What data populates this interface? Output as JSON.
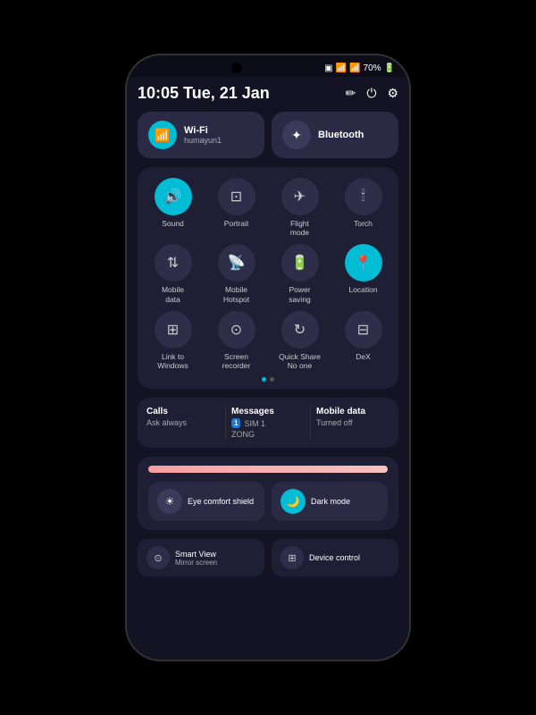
{
  "status_bar": {
    "time": "10:05  Tue, 21 Jan",
    "battery": "70%",
    "battery_icon": "🔋",
    "signal_icon": "📶"
  },
  "header": {
    "pencil_icon": "✏",
    "power_icon": "⏻",
    "settings_icon": "⚙"
  },
  "quick_tiles": {
    "wifi": {
      "label": "Wi-Fi",
      "sublabel": "humayun1",
      "icon": "📶"
    },
    "bluetooth": {
      "label": "Bluetooth",
      "icon": "✦"
    }
  },
  "grid_items": [
    {
      "id": "sound",
      "label": "Sound",
      "icon": "🔊",
      "active": true
    },
    {
      "id": "portrait",
      "label": "Portrait",
      "icon": "⊡",
      "active": false
    },
    {
      "id": "flight",
      "label": "Flight\nmode",
      "icon": "✈",
      "active": false
    },
    {
      "id": "torch",
      "label": "Torch",
      "icon": "🕯",
      "active": false
    },
    {
      "id": "mobile-data",
      "label": "Mobile\ndata",
      "icon": "⇅",
      "active": false
    },
    {
      "id": "hotspot",
      "label": "Mobile\nHotspot",
      "icon": "📡",
      "active": false
    },
    {
      "id": "power-saving",
      "label": "Power\nsaving",
      "icon": "🔋",
      "active": false
    },
    {
      "id": "location",
      "label": "Location",
      "icon": "📍",
      "active": true
    },
    {
      "id": "link-windows",
      "label": "Link to\nWindows",
      "icon": "⊞",
      "active": false
    },
    {
      "id": "screen-recorder",
      "label": "Screen\nrecorder",
      "icon": "⊙",
      "active": false
    },
    {
      "id": "quick-share",
      "label": "Quick Share\nNo one",
      "icon": "↻",
      "active": false
    },
    {
      "id": "dex",
      "label": "DeX",
      "icon": "⊟",
      "active": false
    }
  ],
  "sim_section": {
    "calls": {
      "title": "Calls",
      "sub": "Ask always"
    },
    "messages": {
      "title": "Messages",
      "sim_num": "1",
      "network": "SIM 1",
      "carrier": "ZONG"
    },
    "mobile_data": {
      "title": "Mobile data",
      "sub": "Turned off"
    }
  },
  "brightness": {
    "label": "Brightness"
  },
  "comfort_items": [
    {
      "id": "eye-comfort",
      "label": "Eye comfort shield",
      "icon": "☀",
      "active": false
    },
    {
      "id": "dark-mode",
      "label": "Dark mode",
      "icon": "🌙",
      "active": true
    }
  ],
  "bottom_tiles": [
    {
      "id": "smart-view",
      "label": "Smart View",
      "sub": "Mirror screen",
      "icon": "⊙"
    },
    {
      "id": "device-control",
      "label": "Device control",
      "sub": "",
      "icon": "⊞"
    }
  ]
}
